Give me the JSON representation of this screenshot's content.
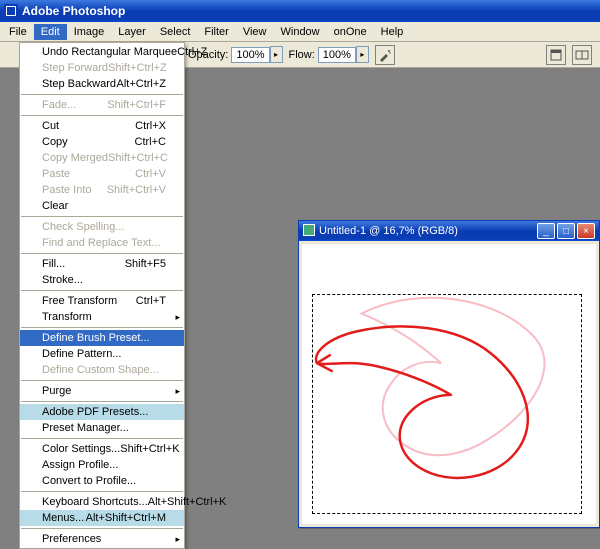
{
  "app_title": "Adobe Photoshop",
  "menubar": [
    "File",
    "Edit",
    "Image",
    "Layer",
    "Select",
    "Filter",
    "View",
    "Window",
    "onOne",
    "Help"
  ],
  "options": {
    "opacity_label": "Opacity:",
    "opacity_value": "100%",
    "flow_label": "Flow:",
    "flow_value": "100%"
  },
  "document": {
    "title": "Untitled-1 @ 16,7% (RGB/8)"
  },
  "edit_menu": [
    {
      "type": "item",
      "label": "Undo Rectangular Marquee",
      "shortcut": "Ctrl+Z"
    },
    {
      "type": "item",
      "label": "Step Forward",
      "shortcut": "Shift+Ctrl+Z",
      "disabled": true
    },
    {
      "type": "item",
      "label": "Step Backward",
      "shortcut": "Alt+Ctrl+Z"
    },
    {
      "type": "sep"
    },
    {
      "type": "item",
      "label": "Fade...",
      "shortcut": "Shift+Ctrl+F",
      "disabled": true
    },
    {
      "type": "sep"
    },
    {
      "type": "item",
      "label": "Cut",
      "shortcut": "Ctrl+X"
    },
    {
      "type": "item",
      "label": "Copy",
      "shortcut": "Ctrl+C"
    },
    {
      "type": "item",
      "label": "Copy Merged",
      "shortcut": "Shift+Ctrl+C",
      "disabled": true
    },
    {
      "type": "item",
      "label": "Paste",
      "shortcut": "Ctrl+V",
      "disabled": true
    },
    {
      "type": "item",
      "label": "Paste Into",
      "shortcut": "Shift+Ctrl+V",
      "disabled": true
    },
    {
      "type": "item",
      "label": "Clear",
      "shortcut": ""
    },
    {
      "type": "sep"
    },
    {
      "type": "item",
      "label": "Check Spelling...",
      "shortcut": "",
      "disabled": true
    },
    {
      "type": "item",
      "label": "Find and Replace Text...",
      "shortcut": "",
      "disabled": true
    },
    {
      "type": "sep"
    },
    {
      "type": "item",
      "label": "Fill...",
      "shortcut": "Shift+F5"
    },
    {
      "type": "item",
      "label": "Stroke...",
      "shortcut": ""
    },
    {
      "type": "sep"
    },
    {
      "type": "item",
      "label": "Free Transform",
      "shortcut": "Ctrl+T"
    },
    {
      "type": "item",
      "label": "Transform",
      "shortcut": "",
      "submenu": true
    },
    {
      "type": "sep"
    },
    {
      "type": "item",
      "label": "Define Brush Preset...",
      "shortcut": "",
      "hi": "blue"
    },
    {
      "type": "item",
      "label": "Define Pattern...",
      "shortcut": ""
    },
    {
      "type": "item",
      "label": "Define Custom Shape...",
      "shortcut": "",
      "disabled": true
    },
    {
      "type": "sep"
    },
    {
      "type": "item",
      "label": "Purge",
      "shortcut": "",
      "submenu": true
    },
    {
      "type": "sep"
    },
    {
      "type": "item",
      "label": "Adobe PDF Presets...",
      "shortcut": "",
      "hi": "teal"
    },
    {
      "type": "item",
      "label": "Preset Manager...",
      "shortcut": ""
    },
    {
      "type": "sep"
    },
    {
      "type": "item",
      "label": "Color Settings...",
      "shortcut": "Shift+Ctrl+K"
    },
    {
      "type": "item",
      "label": "Assign Profile...",
      "shortcut": ""
    },
    {
      "type": "item",
      "label": "Convert to Profile...",
      "shortcut": ""
    },
    {
      "type": "sep"
    },
    {
      "type": "item",
      "label": "Keyboard Shortcuts...",
      "shortcut": "Alt+Shift+Ctrl+K"
    },
    {
      "type": "item",
      "label": "Menus...",
      "shortcut": "Alt+Shift+Ctrl+M",
      "hi": "teal"
    },
    {
      "type": "sep"
    },
    {
      "type": "item",
      "label": "Preferences",
      "shortcut": "",
      "submenu": true
    }
  ]
}
